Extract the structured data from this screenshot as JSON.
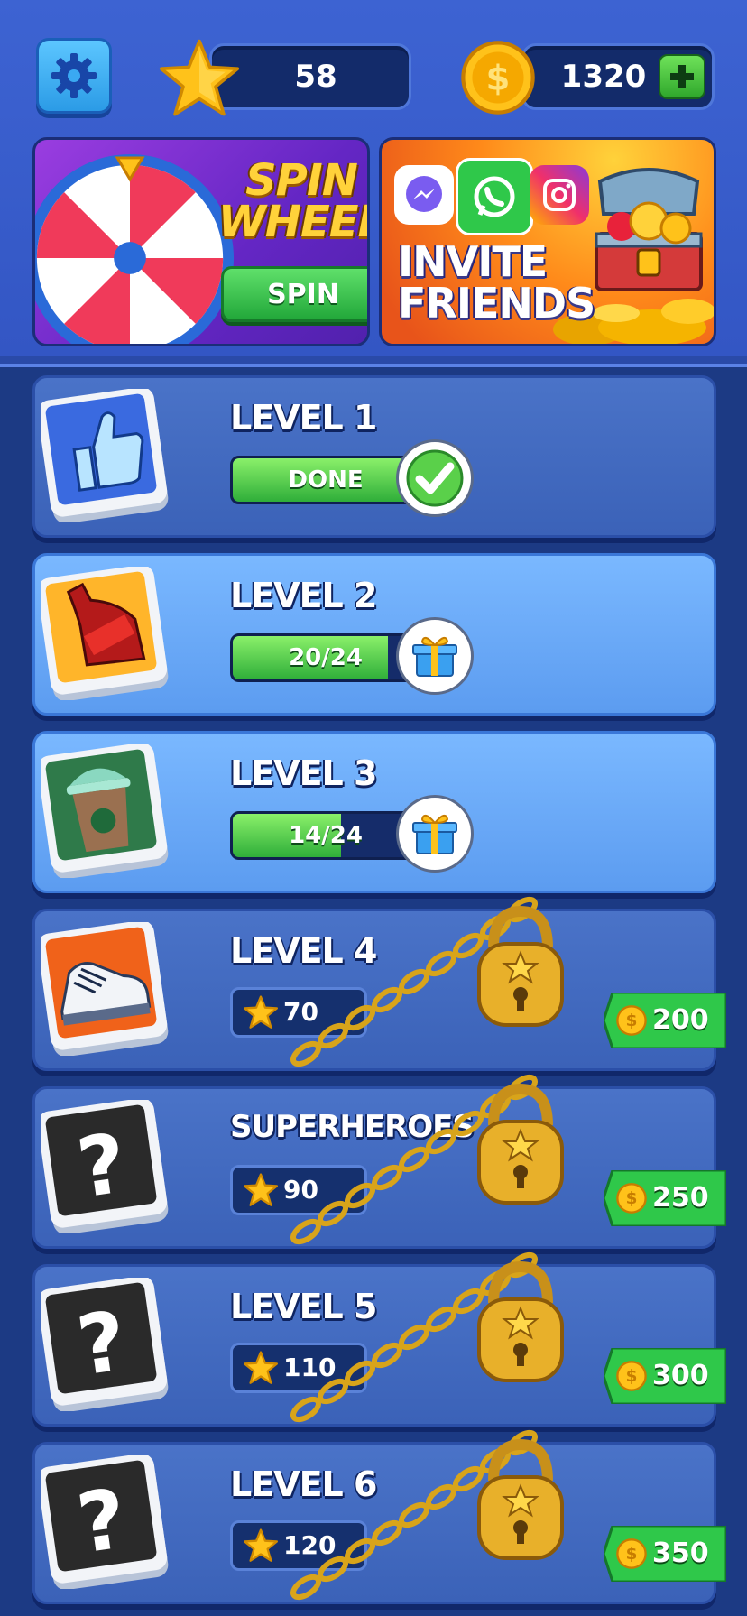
{
  "header": {
    "stars": "58",
    "coins": "1320"
  },
  "banners": {
    "spin": {
      "title_line1": "SPIN",
      "title_line2": "WHEEL",
      "button": "SPIN"
    },
    "invite": {
      "title_line1": "INVITE",
      "title_line2": "FRIENDS"
    }
  },
  "levels": [
    {
      "title": "LEVEL 1",
      "state": "done",
      "bar_text": "DONE",
      "icon": "thumbs-up-icon"
    },
    {
      "title": "LEVEL 2",
      "state": "active",
      "bar_text": "20/24",
      "progress": 0.8333,
      "icon": "soda-bottle-icon"
    },
    {
      "title": "LEVEL 3",
      "state": "active",
      "bar_text": "14/24",
      "progress": 0.5833,
      "icon": "coffee-cup-icon"
    },
    {
      "title": "LEVEL 4",
      "state": "locked",
      "stars_required": "70",
      "price": "200",
      "icon": "sneaker-icon"
    },
    {
      "title": "SUPERHEROES",
      "state": "locked",
      "stars_required": "90",
      "price": "250",
      "icon": "question-mark-icon"
    },
    {
      "title": "LEVEL 5",
      "state": "locked",
      "stars_required": "110",
      "price": "300",
      "icon": "question-mark-icon"
    },
    {
      "title": "LEVEL 6",
      "state": "locked",
      "stars_required": "120",
      "price": "350",
      "icon": "question-mark-icon"
    }
  ],
  "colors": {
    "background": "#1c3a84",
    "header": "#3d63d2",
    "active_level": "#7ab8ff",
    "progress_green": "#2fae3a",
    "gold": "#ffc21a"
  }
}
